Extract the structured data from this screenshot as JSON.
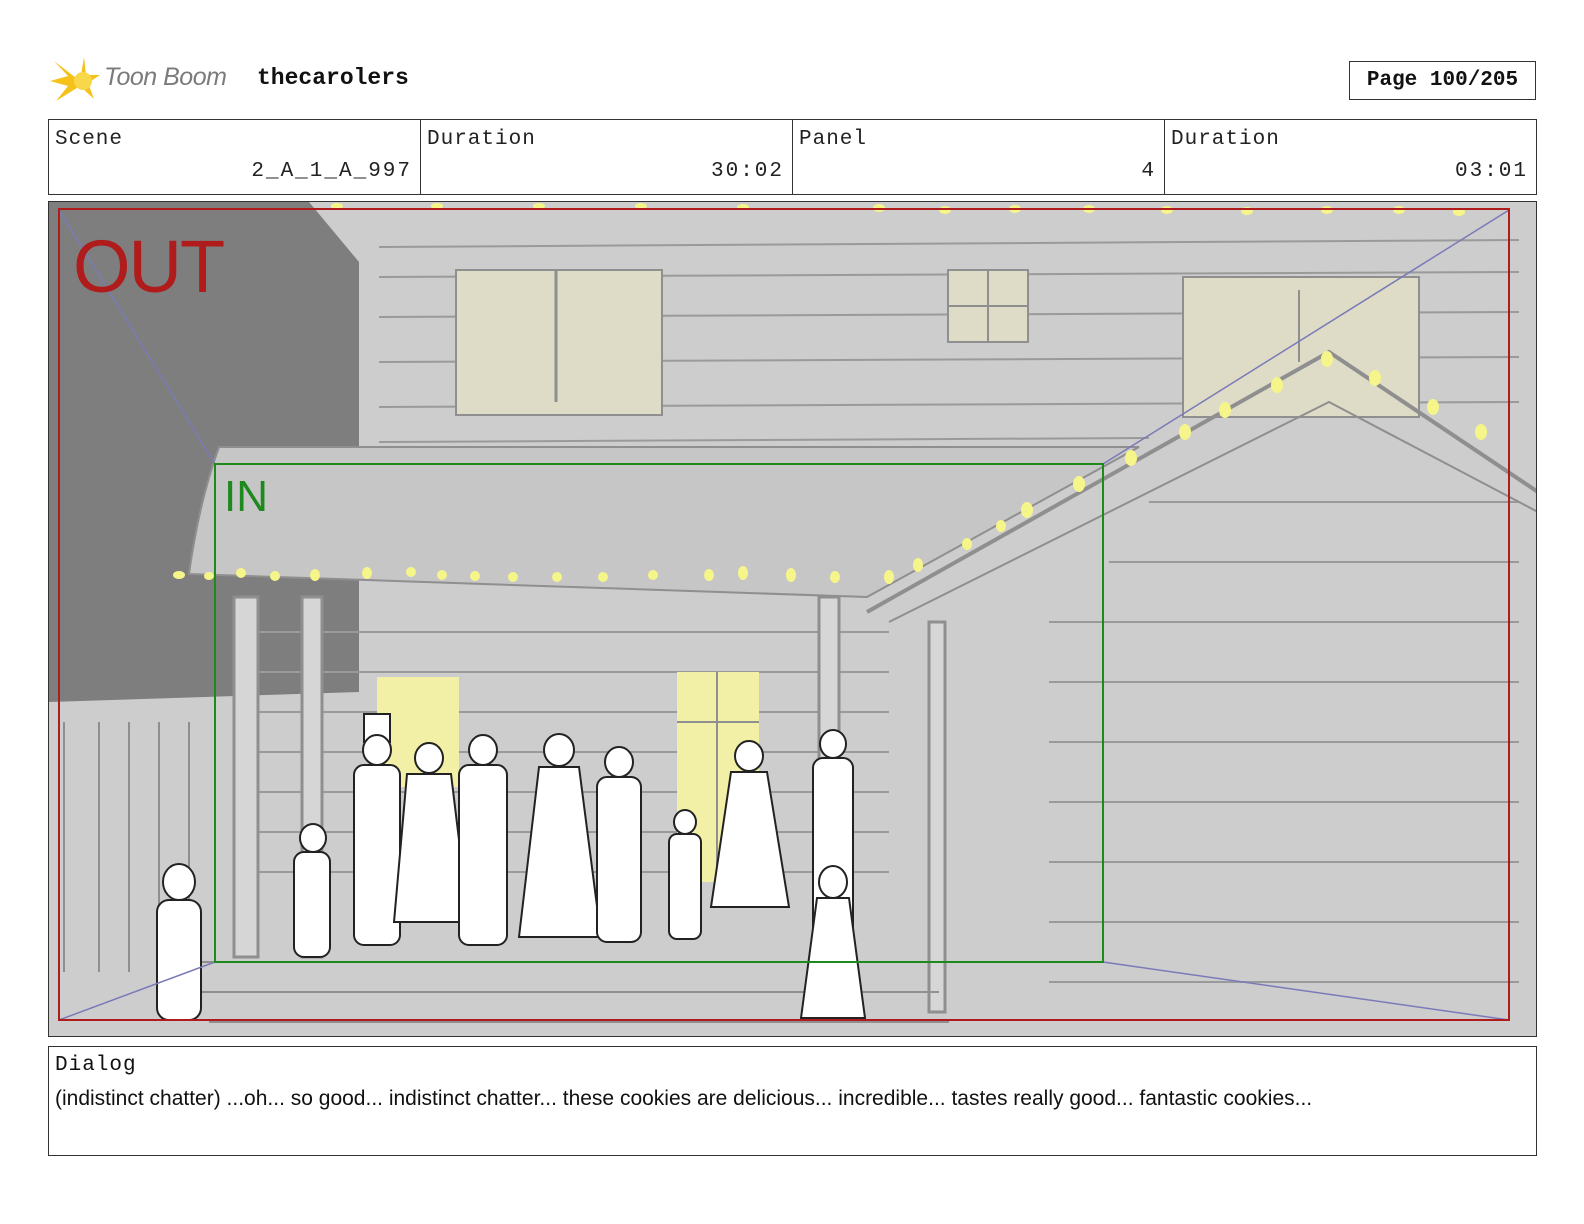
{
  "header": {
    "logo_text": "Toon Boom",
    "project_name": "thecarolers",
    "page_label": "Page 100/205"
  },
  "info": {
    "scene_label": "Scene",
    "scene_value": "2_A_1_A_997",
    "duration_label": "Duration",
    "duration_value": "30:02",
    "panel_label": "Panel",
    "panel_value": "4",
    "panel_duration_label": "Duration",
    "panel_duration_value": "03:01"
  },
  "frame": {
    "out_label": "OUT",
    "in_label": "IN",
    "out_color": "#b01c1c",
    "in_color": "#1e8a1e",
    "guide_color": "#7a7ab8"
  },
  "dialog": {
    "label": "Dialog",
    "text": "(indistinct chatter) ...oh... so good... indistinct chatter... these cookies are delicious... incredible... tastes really good... fantastic cookies..."
  },
  "colors": {
    "logo_star": "#f4c21a",
    "light_bulb": "#f6f58a",
    "window_glow": "#f1f0a6",
    "sky": "#7e7e7e",
    "house": "#cdcdcd"
  }
}
